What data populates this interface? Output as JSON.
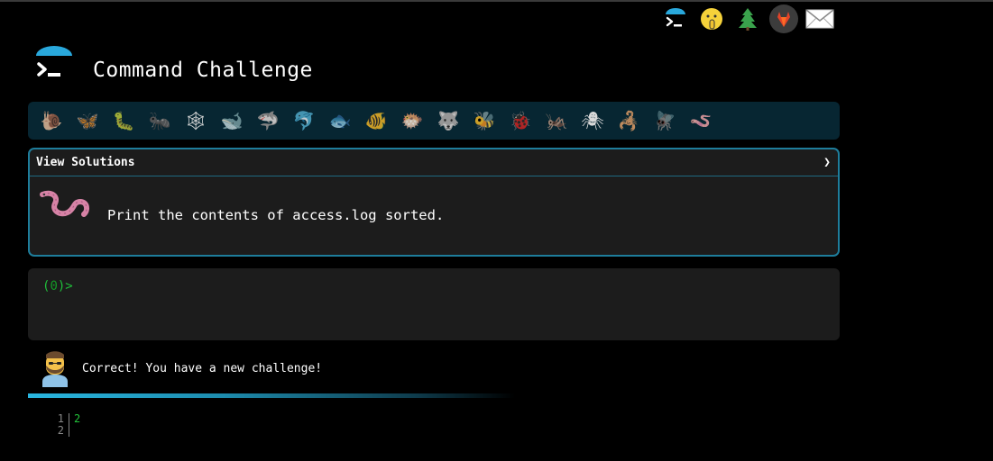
{
  "header": {
    "title": "Command Challenge",
    "icons": [
      "cmd-logo-icon",
      "shushing-face-icon",
      "tree-icon",
      "gitlab-icon",
      "envelope-icon"
    ]
  },
  "animals": [
    {
      "name": "snail-icon",
      "glyph": "🐌"
    },
    {
      "name": "butterfly-icon",
      "glyph": "🦋"
    },
    {
      "name": "caterpillar-icon",
      "glyph": "🐛"
    },
    {
      "name": "ant-icon",
      "glyph": "🐜"
    },
    {
      "name": "spider-web-icon",
      "glyph": "🕸"
    },
    {
      "name": "whale-icon",
      "glyph": "🐋"
    },
    {
      "name": "shark-icon",
      "glyph": "🦈"
    },
    {
      "name": "dolphin-icon",
      "glyph": "🐬"
    },
    {
      "name": "fish-icon",
      "glyph": "🐟"
    },
    {
      "name": "tropical-fish-icon",
      "glyph": "🐠"
    },
    {
      "name": "blowfish-icon",
      "glyph": "🐡"
    },
    {
      "name": "wolf-icon",
      "glyph": "🐺"
    },
    {
      "name": "bee-icon",
      "glyph": "🐝"
    },
    {
      "name": "ladybug-icon",
      "glyph": "🐞"
    },
    {
      "name": "cricket-icon",
      "glyph": "🦗"
    },
    {
      "name": "spider-icon",
      "glyph": "🕷"
    },
    {
      "name": "scorpion-icon",
      "glyph": "🦂"
    },
    {
      "name": "fly-icon",
      "glyph": "🪰"
    },
    {
      "name": "worm-icon",
      "glyph": "🪱"
    }
  ],
  "challenge": {
    "header_label": "View Solutions",
    "chevron": "❯",
    "description": "Print the contents of access.log sorted.",
    "icon": "worm-icon"
  },
  "terminal": {
    "prompt_open": "(",
    "prompt_count": "0",
    "prompt_close": ")>"
  },
  "status": {
    "message": "Correct! You have a new challenge!",
    "avatar": "bearded-man-icon",
    "progress": 1.0
  },
  "output": {
    "line_numbers": [
      "1",
      "2"
    ],
    "lines": [
      "2",
      ""
    ]
  },
  "colors": {
    "background": "#000000",
    "panel": "#1c1c1c",
    "accent": "#1e7d9b",
    "prompt_green": "#1fbf3a"
  }
}
